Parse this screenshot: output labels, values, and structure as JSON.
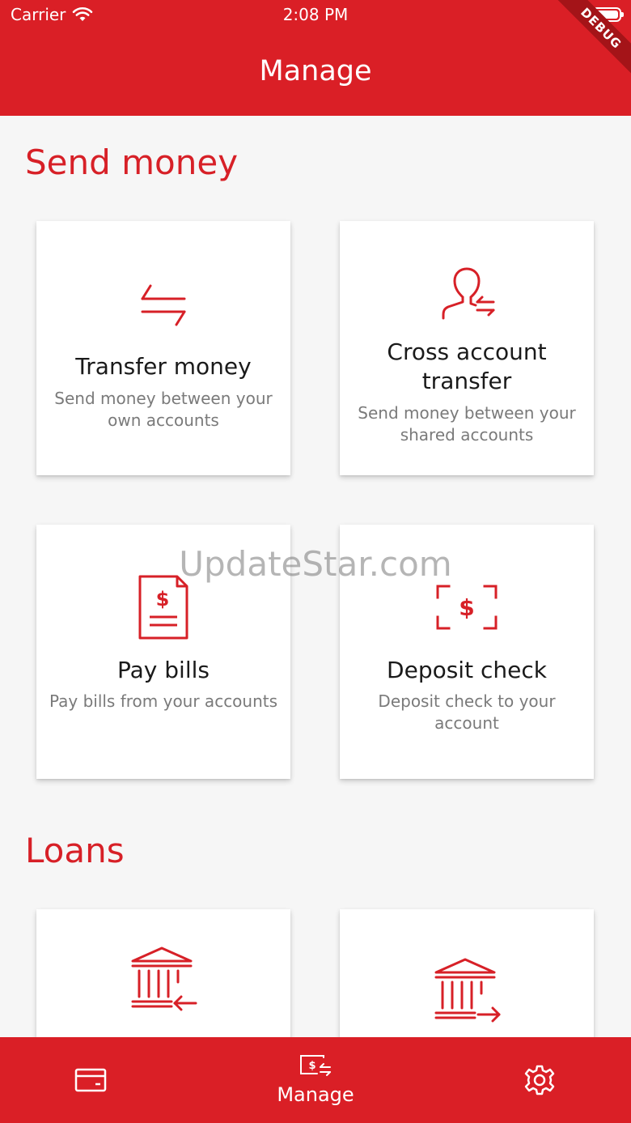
{
  "status_bar": {
    "carrier": "Carrier",
    "time": "2:08 PM"
  },
  "debug_banner": "DEBUG",
  "header": {
    "title": "Manage"
  },
  "sections": [
    {
      "title": "Send money",
      "cards": [
        {
          "icon": "transfer-arrows-icon",
          "title": "Transfer money",
          "description": "Send money between your own accounts"
        },
        {
          "icon": "person-transfer-icon",
          "title": "Cross account transfer",
          "description": "Send money between your shared accounts"
        },
        {
          "icon": "bill-document-icon",
          "title": "Pay bills",
          "description": "Pay bills from your accounts"
        },
        {
          "icon": "check-scan-icon",
          "title": "Deposit check",
          "description": "Deposit check to your account"
        }
      ]
    },
    {
      "title": "Loans",
      "cards": [
        {
          "icon": "bank-arrow-in-icon",
          "title": "",
          "description": ""
        },
        {
          "icon": "bank-arrow-out-icon",
          "title": "",
          "description": ""
        }
      ]
    }
  ],
  "watermark": "UpdateStar.com",
  "bottom_nav": {
    "items": [
      {
        "icon": "card-icon",
        "label": ""
      },
      {
        "icon": "money-transfer-icon",
        "label": "Manage"
      },
      {
        "icon": "gear-icon",
        "label": ""
      }
    ]
  },
  "colors": {
    "brand_red": "#da1f26",
    "background": "#f6f6f6",
    "card": "#ffffff"
  }
}
